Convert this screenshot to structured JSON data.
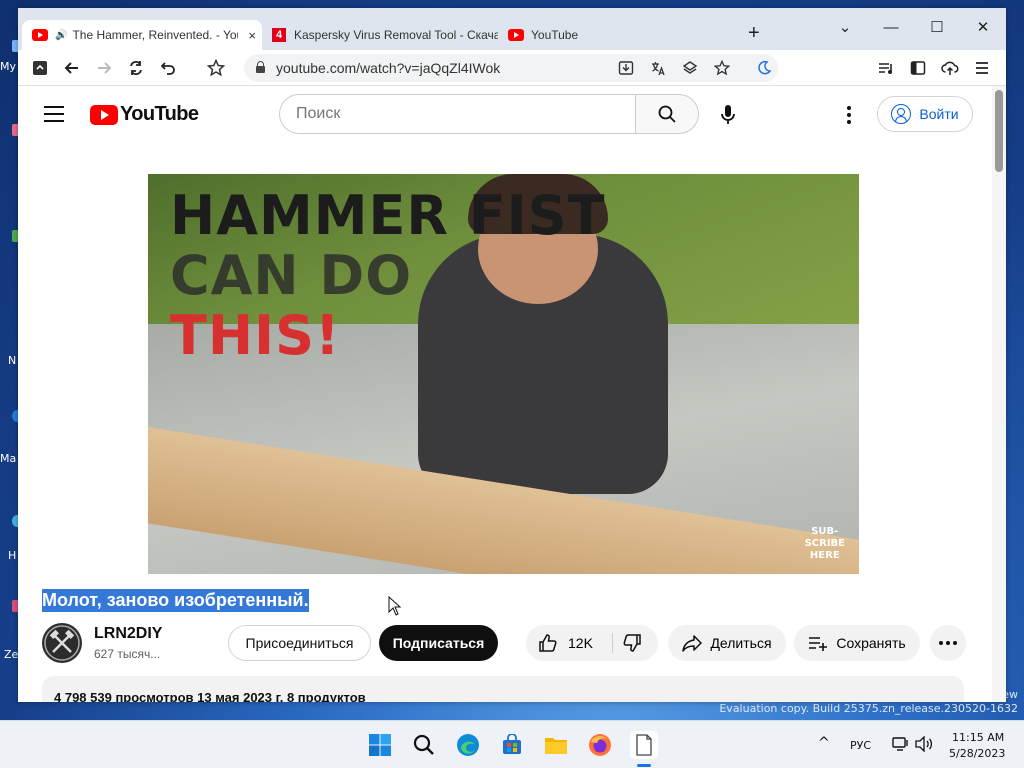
{
  "desktop": {
    "labels": [
      "My",
      "N",
      "Ma",
      "H",
      "Ze"
    ],
    "watermark_line1": "ew",
    "watermark_line2": "Evaluation copy. Build 25375.zn_release.230520-1632"
  },
  "browser": {
    "tabs": [
      {
        "title": "The Hammer, Reinvented. - YouTube",
        "active": true,
        "playing_audio": true,
        "close_label": "×"
      },
      {
        "title": "Kaspersky Virus Removal Tool - Скача",
        "active": false,
        "favicon_letter": "4"
      },
      {
        "title": "YouTube",
        "active": false
      }
    ],
    "new_tab_label": "+",
    "window_controls": {
      "chevron": "⌄",
      "minimize": "—",
      "maximize": "☐",
      "close": "✕"
    },
    "address": "youtube.com/watch?v=jaQqZl4IWok"
  },
  "youtube": {
    "logo_text": "YouTube",
    "search_placeholder": "Поиск",
    "signin_label": "Войти",
    "video": {
      "overlay_line1": "HAMMER FIST",
      "overlay_line2": "CAN DO",
      "overlay_line3": "THIS!",
      "subscribe_overlay": [
        "SUB-",
        "SCRIBE",
        "HERE"
      ]
    },
    "title": "Молот, заново изобретенный.",
    "channel": {
      "name": "LRN2DIY",
      "subscribers": "627 тысяч..."
    },
    "buttons": {
      "join": "Присоединиться",
      "subscribe": "Подписаться",
      "likes": "12K",
      "share": "Делиться",
      "save": "Сохранять"
    },
    "description_summary": "4 798 539 просмотров 13 мая 2023 г. 8 продуктов"
  },
  "taskbar": {
    "language": "РУС",
    "time": "11:15 AM",
    "date": "5/28/2023"
  },
  "colors": {
    "yt_red": "#ff0000",
    "link_blue": "#065fd4",
    "selection_blue": "#3478d8",
    "overlay_dark": "#1c1c1c",
    "overlay_red": "#d63031"
  }
}
